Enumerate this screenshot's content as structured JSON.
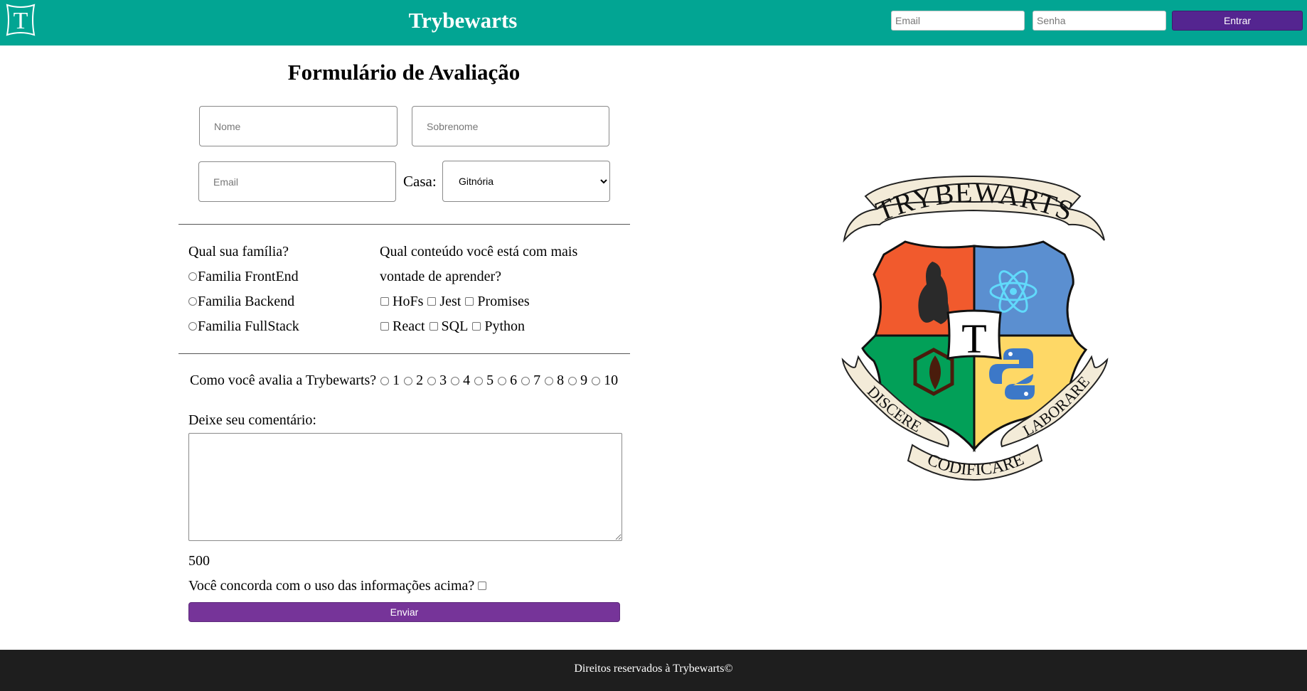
{
  "header": {
    "logo_letter": "T",
    "brand": "Trybewarts",
    "login": {
      "email_placeholder": "Email",
      "password_placeholder": "Senha",
      "button_label": "Entrar"
    },
    "colors": {
      "background": "#02a593",
      "button": "#542590"
    }
  },
  "form": {
    "title": "Formulário de Avaliação",
    "first_name_placeholder": "Nome",
    "last_name_placeholder": "Sobrenome",
    "email_placeholder": "Email",
    "house_label": "Casa:",
    "house_selected": "Gitnória",
    "family": {
      "question": "Qual sua família?",
      "options": [
        "Familia FrontEnd",
        "Familia Backend",
        "Familia FullStack"
      ]
    },
    "content": {
      "question_line1": "Qual conteúdo você está com mais",
      "question_line2": "vontade de aprender?",
      "options": [
        "HoFs",
        "Jest",
        "Promises",
        "React",
        "SQL",
        "Python"
      ]
    },
    "rating": {
      "question": "Como você avalia a Trybewarts?",
      "options": [
        "1",
        "2",
        "3",
        "4",
        "5",
        "6",
        "7",
        "8",
        "9",
        "10"
      ]
    },
    "comment_label": "Deixe seu comentário:",
    "char_counter": "500",
    "agreement_label": "Você concorda com o uso das informações acima?",
    "submit_label": "Enviar",
    "colors": {
      "submit": "#763499"
    }
  },
  "crest": {
    "top_banner": "TRYBEWARTS",
    "center_letter": "T",
    "left_banner": "DISCERE",
    "bottom_banner": "CODIFICARE",
    "right_banner": "LABORARE",
    "quadrant_colors": [
      "#f15a2d",
      "#5b8fd0",
      "#02a058",
      "#fed866"
    ]
  },
  "footer": {
    "text": "Direitos reservados à Trybewarts©",
    "background": "#1e1e1e"
  }
}
